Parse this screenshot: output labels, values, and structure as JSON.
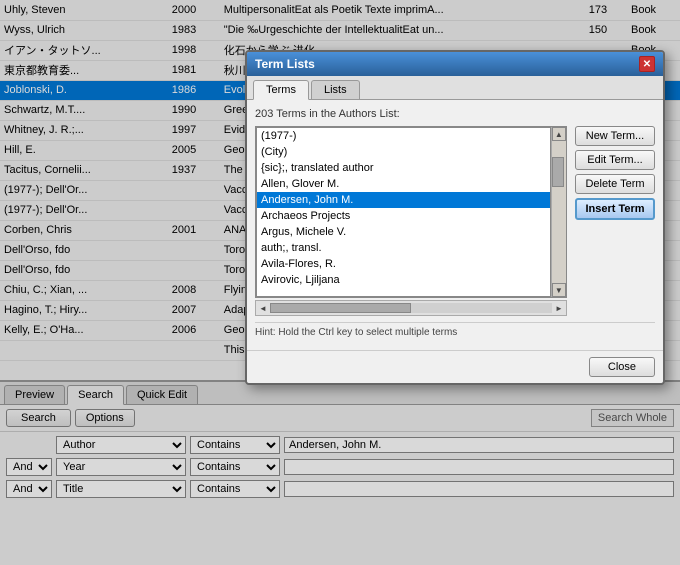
{
  "table": {
    "rows": [
      {
        "col1": "Uhly, Steven",
        "col2": "2000",
        "col3": "MultipersonalitEat als Poetik Texte imprimA...",
        "col4": "173",
        "col5": "Book"
      },
      {
        "col1": "Wyss, Ulrich",
        "col2": "1983",
        "col3": "\"Die ‰Urgeschichte der IntellektualitEat un...",
        "col4": "150",
        "col5": "Book"
      },
      {
        "col1": "イアン・タットソ...",
        "col2": "1998",
        "col3": "化石から学ぶ 进化...",
        "col4": "",
        "col5": "Book"
      },
      {
        "col1": "東京都教育委...",
        "col2": "1981",
        "col3": "秋川市...",
        "col4": "",
        "col5": ""
      },
      {
        "col1": "Joblonski, D.",
        "col2": "1986",
        "col3": "Evolution...",
        "col4": "",
        "col5": ""
      },
      {
        "col1": "Schwartz, M.T....",
        "col2": "1990",
        "col3": "Greenho...",
        "col4": "",
        "col5": ""
      },
      {
        "col1": "Whitney, J. R.;...",
        "col2": "1997",
        "col3": "Evidence...",
        "col4": "",
        "col5": ""
      },
      {
        "col1": "Hill, E.",
        "col2": "2005",
        "col3": "Geologic...",
        "col4": "",
        "col5": ""
      },
      {
        "col1": "Tacitus, Cornelii...",
        "col2": "1937",
        "col3": "The histo...",
        "col4": "",
        "col5": ""
      },
      {
        "col1": "(1977-); Dell'Or...",
        "col2": "",
        "col3": "Vacca P...",
        "col4": "",
        "col5": ""
      },
      {
        "col1": "(1977-); Dell'Or...",
        "col2": "",
        "col3": "Vacca P...",
        "col4": "",
        "col5": ""
      },
      {
        "col1": "Corben, Chris",
        "col2": "2001",
        "col3": "ANABAT...",
        "col4": "",
        "col5": ""
      },
      {
        "col1": "Dell'Orso, fdo",
        "col2": "",
        "col3": "Toronto T...",
        "col4": "",
        "col5": ""
      },
      {
        "col1": "Dell'Orso, fdo",
        "col2": "",
        "col3": "Toronto W...",
        "col4": "",
        "col5": ""
      },
      {
        "col1": "Chiu, C.; Xian, ...",
        "col2": "2008",
        "col3": "Flying in...",
        "col4": "",
        "col5": ""
      },
      {
        "col1": "Hagino, T.; Hiry...",
        "col2": "2007",
        "col3": "Adaptive...",
        "col4": "",
        "col5": ""
      },
      {
        "col1": "Kelly, E.; O'Ha...",
        "col2": "2006",
        "col3": "Geograph...",
        "col4": "",
        "col5": ""
      },
      {
        "col1": "",
        "col2": "",
        "col3": "This is a...",
        "col4": "",
        "col5": ""
      }
    ],
    "selected_row": 4
  },
  "bottom_panel": {
    "tabs": [
      {
        "label": "Preview",
        "active": false
      },
      {
        "label": "Search",
        "active": true
      },
      {
        "label": "Quick Edit",
        "active": false
      }
    ],
    "search_button": "Search",
    "options_button": "Options",
    "search_whole_label": "Search Whole",
    "rows": [
      {
        "field": "Author",
        "condition": "Contains",
        "value": "Andersen, John M."
      },
      {
        "and_label": "And",
        "field": "Year",
        "condition": "Contains",
        "value": ""
      },
      {
        "and_label": "And",
        "field": "Title",
        "condition": "Contains",
        "value": ""
      }
    ]
  },
  "dialog": {
    "title": "Term Lists",
    "tabs": [
      {
        "label": "Terms",
        "active": true
      },
      {
        "label": "Lists",
        "active": false
      }
    ],
    "info": "203 Terms in the Authors List:",
    "terms": [
      "(1977-)",
      "(City)",
      "{sic};, translated author",
      "Allen, Glover M.",
      "Andersen, John M.",
      "Archaeos Projects",
      "Argus, Michele V.",
      "auth;, transl.",
      "Avila-Flores, R.",
      "Avirovic, Ljiljana"
    ],
    "selected_term": "Andersen, John M.",
    "buttons": {
      "new_term": "New Term...",
      "edit_term": "Edit Term...",
      "delete_term": "Delete Term",
      "insert_term": "Insert Term"
    },
    "hint": "Hint: Hold the Ctrl key to select multiple terms",
    "close": "Close"
  }
}
